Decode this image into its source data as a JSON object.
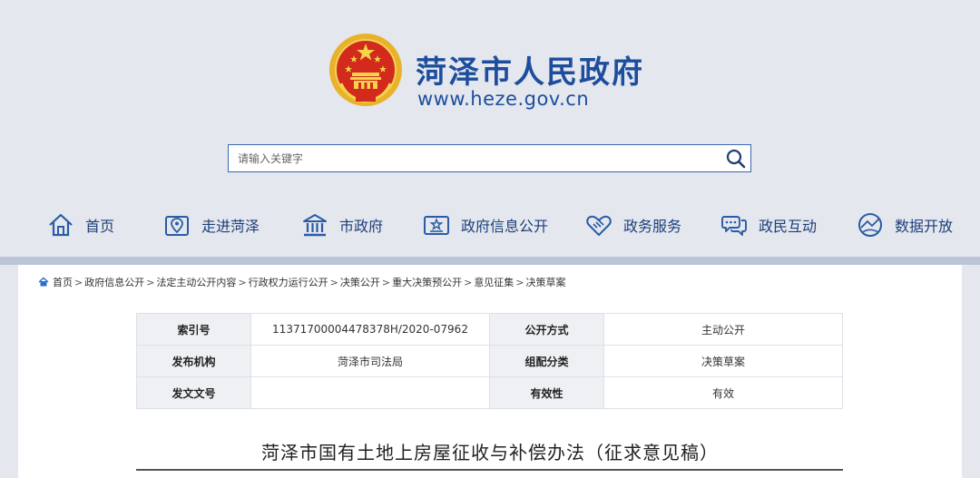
{
  "header": {
    "site_title": "菏泽市人民政府",
    "site_url": "www.heze.gov.cn",
    "brand_color": "#1d4e9d",
    "emblem_icon": "national-emblem-icon"
  },
  "search": {
    "placeholder": "请输入关键字",
    "icon": "search-icon"
  },
  "nav": {
    "items": [
      {
        "label": "首页",
        "icon": "home-icon"
      },
      {
        "label": "走进菏泽",
        "icon": "map-pin-icon"
      },
      {
        "label": "市政府",
        "icon": "government-building-icon"
      },
      {
        "label": "政府信息公开",
        "icon": "open-info-icon"
      },
      {
        "label": "政务服务",
        "icon": "handshake-icon"
      },
      {
        "label": "政民互动",
        "icon": "chat-bubbles-icon"
      },
      {
        "label": "数据开放",
        "icon": "data-sphere-icon"
      }
    ]
  },
  "breadcrumb": {
    "separator": ">",
    "items": [
      "首页",
      "政府信息公开",
      "法定主动公开内容",
      "行政权力运行公开",
      "决策公开",
      "重大决策预公开",
      "意见征集",
      "决策草案"
    ]
  },
  "info_table": {
    "rows": [
      {
        "k1": "索引号",
        "v1": "11371700004478378H/2020-07962",
        "k2": "公开方式",
        "v2": "主动公开"
      },
      {
        "k1": "发布机构",
        "v1": "菏泽市司法局",
        "k2": "组配分类",
        "v2": "决策草案"
      },
      {
        "k1": "发文文号",
        "v1": "",
        "k2": "有效性",
        "v2": "有效"
      }
    ]
  },
  "document": {
    "title": "菏泽市国有土地上房屋征收与补偿办法（征求意见稿）"
  }
}
